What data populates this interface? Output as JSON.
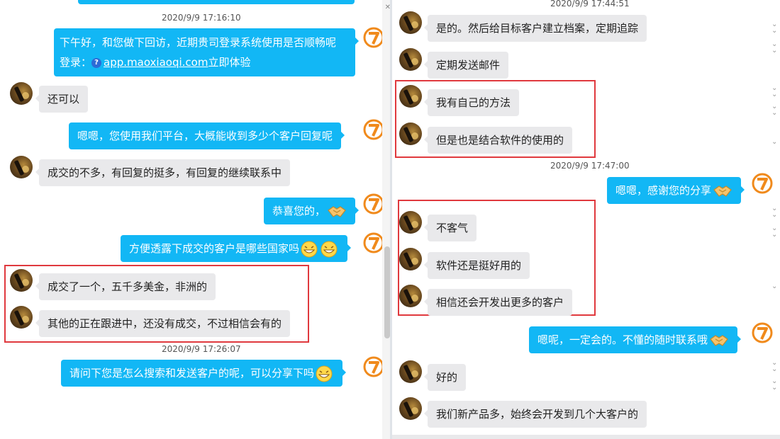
{
  "left": {
    "timestamps": [
      "2020/9/9 17:16:10",
      "2020/9/9 17:26:07"
    ],
    "messages": [
      {
        "line1": "下午好，和您做下回访，近期贵司登录系统使用是否顺畅呢",
        "line2_prefix": "登录：",
        "link": "app.maoxiaoqi.com",
        "line2_suffix": "立即体验",
        "link_badge": "?"
      },
      {
        "text": "还可以"
      },
      {
        "text": "嗯嗯，您使用我们平台，大概能收到多少个客户回复呢"
      },
      {
        "text": "成交的不多，有回复的挺多，有回复的继续联系中"
      },
      {
        "text": "恭喜您的，",
        "emoji": "handshake-emoji"
      },
      {
        "text": "方便透露下成交的客户是哪些国家吗",
        "emoji": "grin-emoji"
      },
      {
        "text": "成交了一个，五千多美金，非洲的"
      },
      {
        "text": "其他的正在跟进中，还没有成交，不过相信会有的"
      },
      {
        "text": "请问下您是怎么搜索和发送客户的呢，可以分享下吗",
        "emoji": "grin-emoji"
      }
    ]
  },
  "right": {
    "timestamps": [
      "2020/9/9 17:44:51",
      "2020/9/9 17:47:00"
    ],
    "messages": [
      {
        "text": "是的。然后给目标客户建立档案，定期追踪"
      },
      {
        "text": "定期发送邮件"
      },
      {
        "text": "我有自己的方法"
      },
      {
        "text": "但是也是结合软件的使用的"
      },
      {
        "text": "嗯嗯，感谢您的分享",
        "emoji": "handshake-emoji"
      },
      {
        "text": "不客气"
      },
      {
        "text": "软件还是挺好用的"
      },
      {
        "text": "相信还会开发出更多的客户"
      },
      {
        "text": "嗯呢，一定会的。不懂的随时联系哦",
        "emoji": "handshake-emoji"
      },
      {
        "text": "好的"
      },
      {
        "text": "我们新产品多，始终会开发到几个大客户的"
      }
    ]
  },
  "colors": {
    "outgoing_bubble": "#12b7f5",
    "incoming_bubble": "#e9e9eb",
    "highlight_box": "#e0393e",
    "brand_logo": "#f08a1c"
  },
  "icons": {
    "customer_avatar": "avatar-icon",
    "agent_avatar": "brand-logo-icon"
  }
}
